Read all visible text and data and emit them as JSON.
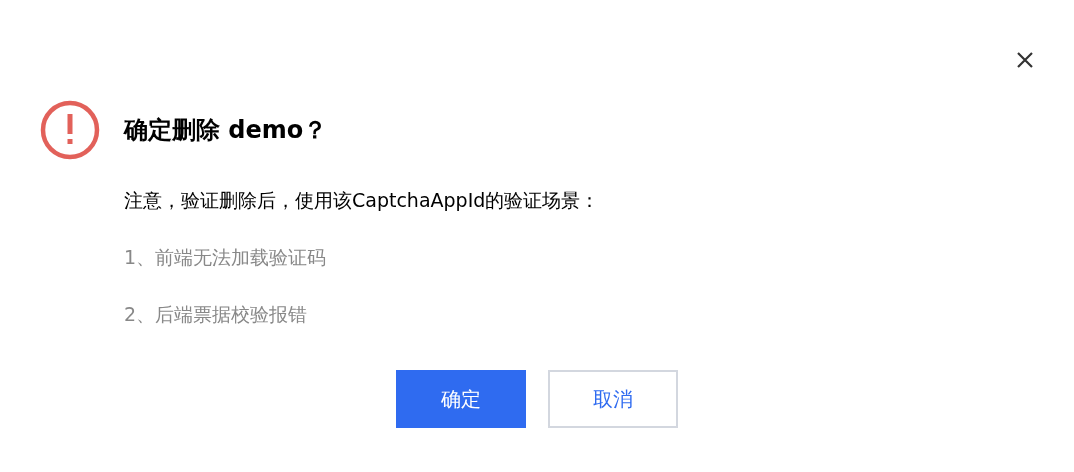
{
  "dialog": {
    "title": "确定删除 demo？",
    "message": "注意，验证删除后，使用该CaptchaAppId的验证场景：",
    "items": [
      "1、前端无法加载验证码",
      "2、后端票据校验报错"
    ],
    "buttons": [
      {
        "label": "确定",
        "kind": "primary"
      },
      {
        "label": "取消",
        "kind": "default"
      }
    ]
  }
}
